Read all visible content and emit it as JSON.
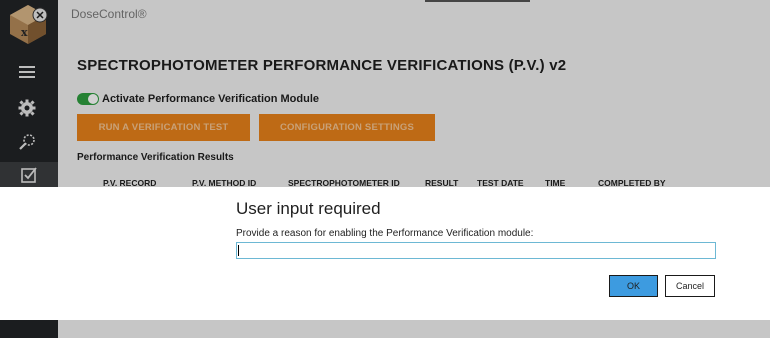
{
  "app": {
    "title": "DoseControl®"
  },
  "sidebar": {
    "items": [
      {
        "name": "menu",
        "icon": "hamburger-icon"
      },
      {
        "name": "settings",
        "icon": "gear-icon"
      },
      {
        "name": "search",
        "icon": "search-icon"
      },
      {
        "name": "verifications",
        "icon": "checkbox-icon",
        "active": true
      }
    ]
  },
  "main": {
    "page_title": "SPECTROPHOTOMETER PERFORMANCE VERIFICATIONS (P.V.) v2",
    "toggle_label": "Activate Performance Verification Module",
    "toggle_on": true,
    "run_button": "RUN A VERIFICATION TEST",
    "config_button": "CONFIGURATION SETTINGS",
    "results_title": "Performance Verification Results",
    "table_headers": [
      "P.V. RECORD",
      "P.V. METHOD ID",
      "SPECTROPHOTOMETER ID",
      "RESULT",
      "TEST DATE",
      "TIME",
      "COMPLETED BY"
    ]
  },
  "dialog": {
    "title": "User input required",
    "prompt": "Provide a reason for enabling the Performance Verification module:",
    "input_value": "",
    "ok_label": "OK",
    "cancel_label": "Cancel"
  },
  "colors": {
    "sidebar": "#222426",
    "accent_orange": "#e8821a",
    "toggle_green": "#2e9e3f",
    "ok_blue": "#3d9be0",
    "input_border": "#6db8d4"
  }
}
